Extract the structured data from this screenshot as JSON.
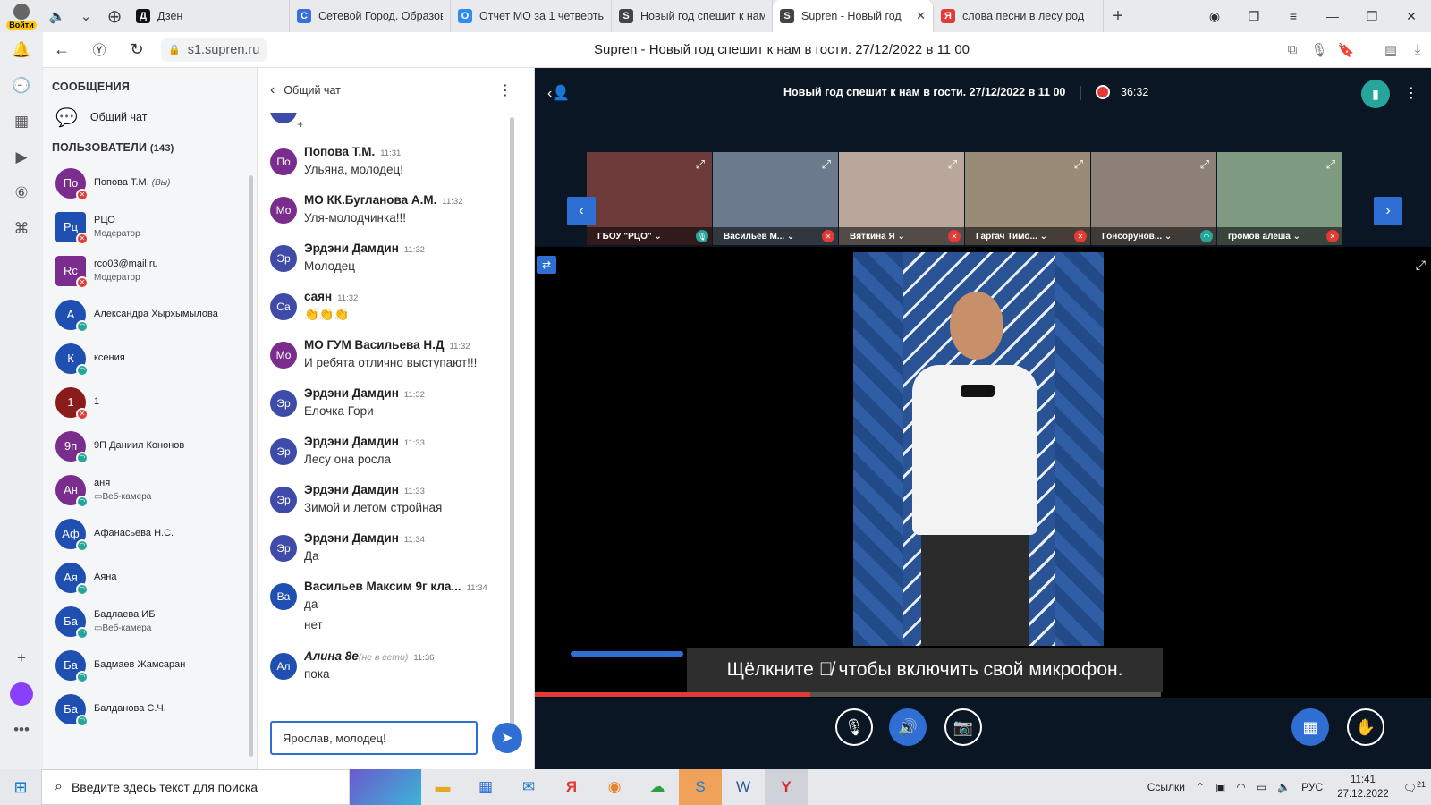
{
  "browser": {
    "login_label": "Войти",
    "tabs": [
      {
        "title": "Дзен",
        "fav": "Д",
        "color": "#111111"
      },
      {
        "title": "Сетевой Город. Образов",
        "fav": "С",
        "color": "#3b6fd8"
      },
      {
        "title": "Отчет МО за 1 четверть",
        "fav": "О",
        "color": "#2f8cf0"
      },
      {
        "title": "Новый год спешит к нам",
        "fav": "S",
        "color": "#444444"
      },
      {
        "title": "Supren - Новый год",
        "fav": "S",
        "color": "#444444",
        "active": true
      },
      {
        "title": "слова песни в лесу род",
        "fav": "Я",
        "color": "#e53935"
      }
    ],
    "url": "s1.supren.ru",
    "page_title": "Supren - Новый год спешит к нам в гости. 27/12/2022 в 11 00"
  },
  "users_panel": {
    "messages_heading": "СООБЩЕНИЯ",
    "general_chat": "Общий чат",
    "users_heading": "ПОЛЬЗОВАТЕЛИ",
    "users_count": "(143)",
    "users": [
      {
        "initials": "По",
        "name": "Попова Т.М.",
        "sub": "(Вы)",
        "color": "#7b2d8e",
        "status": "mute",
        "inline_sub": true
      },
      {
        "initials": "Рц",
        "name": "РЦО",
        "sub": "Модератор",
        "color": "#1f4fb0",
        "status": "mute",
        "square": true
      },
      {
        "initials": "Rc",
        "name": "rco03@mail.ru",
        "sub": "Модератор",
        "color": "#7b2d8e",
        "status": "mute",
        "square": true
      },
      {
        "initials": "А",
        "name": "Александра Хырхымылова",
        "sub": "",
        "color": "#1f4fb0",
        "status": "on"
      },
      {
        "initials": "К",
        "name": "ксения",
        "sub": "",
        "color": "#1f4fb0",
        "status": "on"
      },
      {
        "initials": "1",
        "name": "1",
        "sub": "",
        "color": "#8a1b1b",
        "status": "mute"
      },
      {
        "initials": "9п",
        "name": "9П Даниил Кононов",
        "sub": "",
        "color": "#7b2d8e",
        "status": "on"
      },
      {
        "initials": "Ан",
        "name": "аня",
        "sub": "▭Веб-камера",
        "color": "#7b2d8e",
        "status": "on"
      },
      {
        "initials": "Аф",
        "name": "Афанасьева Н.С.",
        "sub": "",
        "color": "#1f4fb0",
        "status": "on"
      },
      {
        "initials": "Ая",
        "name": "Аяна",
        "sub": "",
        "color": "#1f4fb0",
        "status": "on"
      },
      {
        "initials": "Ба",
        "name": "Бадлаева ИБ",
        "sub": "▭Веб-камера",
        "color": "#1f4fb0",
        "status": "on"
      },
      {
        "initials": "Ба",
        "name": "Бадмаев Жамсаран",
        "sub": "",
        "color": "#1f4fb0",
        "status": "on"
      },
      {
        "initials": "Ба",
        "name": "Балданова С.Ч.",
        "sub": "",
        "color": "#1f4fb0",
        "status": "on"
      }
    ]
  },
  "chat": {
    "title": "Общий чат",
    "messages": [
      {
        "initials": "По",
        "author": "Попова Т.М.",
        "time": "11:31",
        "lines": [
          "Ульяна, молодец!"
        ],
        "color": "#7b2d8e"
      },
      {
        "initials": "Мо",
        "author": "МО КК.Бугланова А.М.",
        "time": "11:32",
        "lines": [
          "Уля-молодчинка!!!"
        ],
        "color": "#7b2d8e"
      },
      {
        "initials": "Эр",
        "author": "Эрдэни Дамдин",
        "time": "11:32",
        "lines": [
          "Молодец"
        ],
        "color": "#3f4ba8"
      },
      {
        "initials": "Са",
        "author": "саян",
        "time": "11:32",
        "lines": [
          "👏👏👏"
        ],
        "color": "#3f4ba8"
      },
      {
        "initials": "Мо",
        "author": "МО ГУМ Васильева Н.Д",
        "time": "11:32",
        "lines": [
          "И ребята отлично выступают!!!"
        ],
        "color": "#7b2d8e"
      },
      {
        "initials": "Эр",
        "author": "Эрдэни Дамдин",
        "time": "11:32",
        "lines": [
          "Елочка Гори"
        ],
        "color": "#3f4ba8"
      },
      {
        "initials": "Эр",
        "author": "Эрдэни Дамдин",
        "time": "11:33",
        "lines": [
          "Лесу она росла"
        ],
        "color": "#3f4ba8"
      },
      {
        "initials": "Эр",
        "author": "Эрдэни Дамдин",
        "time": "11:33",
        "lines": [
          "Зимой и летом стройная"
        ],
        "color": "#3f4ba8"
      },
      {
        "initials": "Эр",
        "author": "Эрдэни Дамдин",
        "time": "11:34",
        "lines": [
          "Да"
        ],
        "color": "#3f4ba8"
      },
      {
        "initials": "Ва",
        "author": "Васильев Максим 9г кла...",
        "time": "11:34",
        "lines": [
          "да",
          "нет"
        ],
        "color": "#1f4fb0"
      },
      {
        "initials": "Ал",
        "author": "Алина 8е",
        "offline": "(не в сети)",
        "time": "11:36",
        "lines": [
          "пока"
        ],
        "color": "#1f4fb0",
        "italic": true
      }
    ],
    "input_value": "Ярослав, молодец!"
  },
  "conference": {
    "title": "Новый год спешит к нам в гости. 27/12/2022 в 11 00",
    "rec_time": "36:32",
    "tiles": [
      {
        "name": "ГБОУ \"РЦО\" ⌄",
        "icon": "mic-on",
        "bg": "#6e3b3b"
      },
      {
        "name": "Васильев М... ⌄",
        "icon": "mute",
        "bg": "#6b7a8c"
      },
      {
        "name": "Вяткина Я ⌄",
        "icon": "mute",
        "bg": "#b9a79b"
      },
      {
        "name": "Гаргач Тимо... ⌄",
        "icon": "mute",
        "bg": "#9a8a78"
      },
      {
        "name": "Гонсорунов... ⌄",
        "icon": "headset",
        "bg": "#8d8079"
      },
      {
        "name": "громов алеша ⌄",
        "icon": "mute",
        "bg": "#7e9a80"
      }
    ],
    "caption_before": "Щёлкните",
    "caption_after": "чтобы включить свой микрофон.",
    "progress": 0.44
  },
  "taskbar": {
    "search_placeholder": "Введите здесь текст для поиска",
    "links_label": "Ссылки",
    "lang": "РУС",
    "time": "11:41",
    "date": "27.12.2022",
    "notif_count": "21"
  }
}
